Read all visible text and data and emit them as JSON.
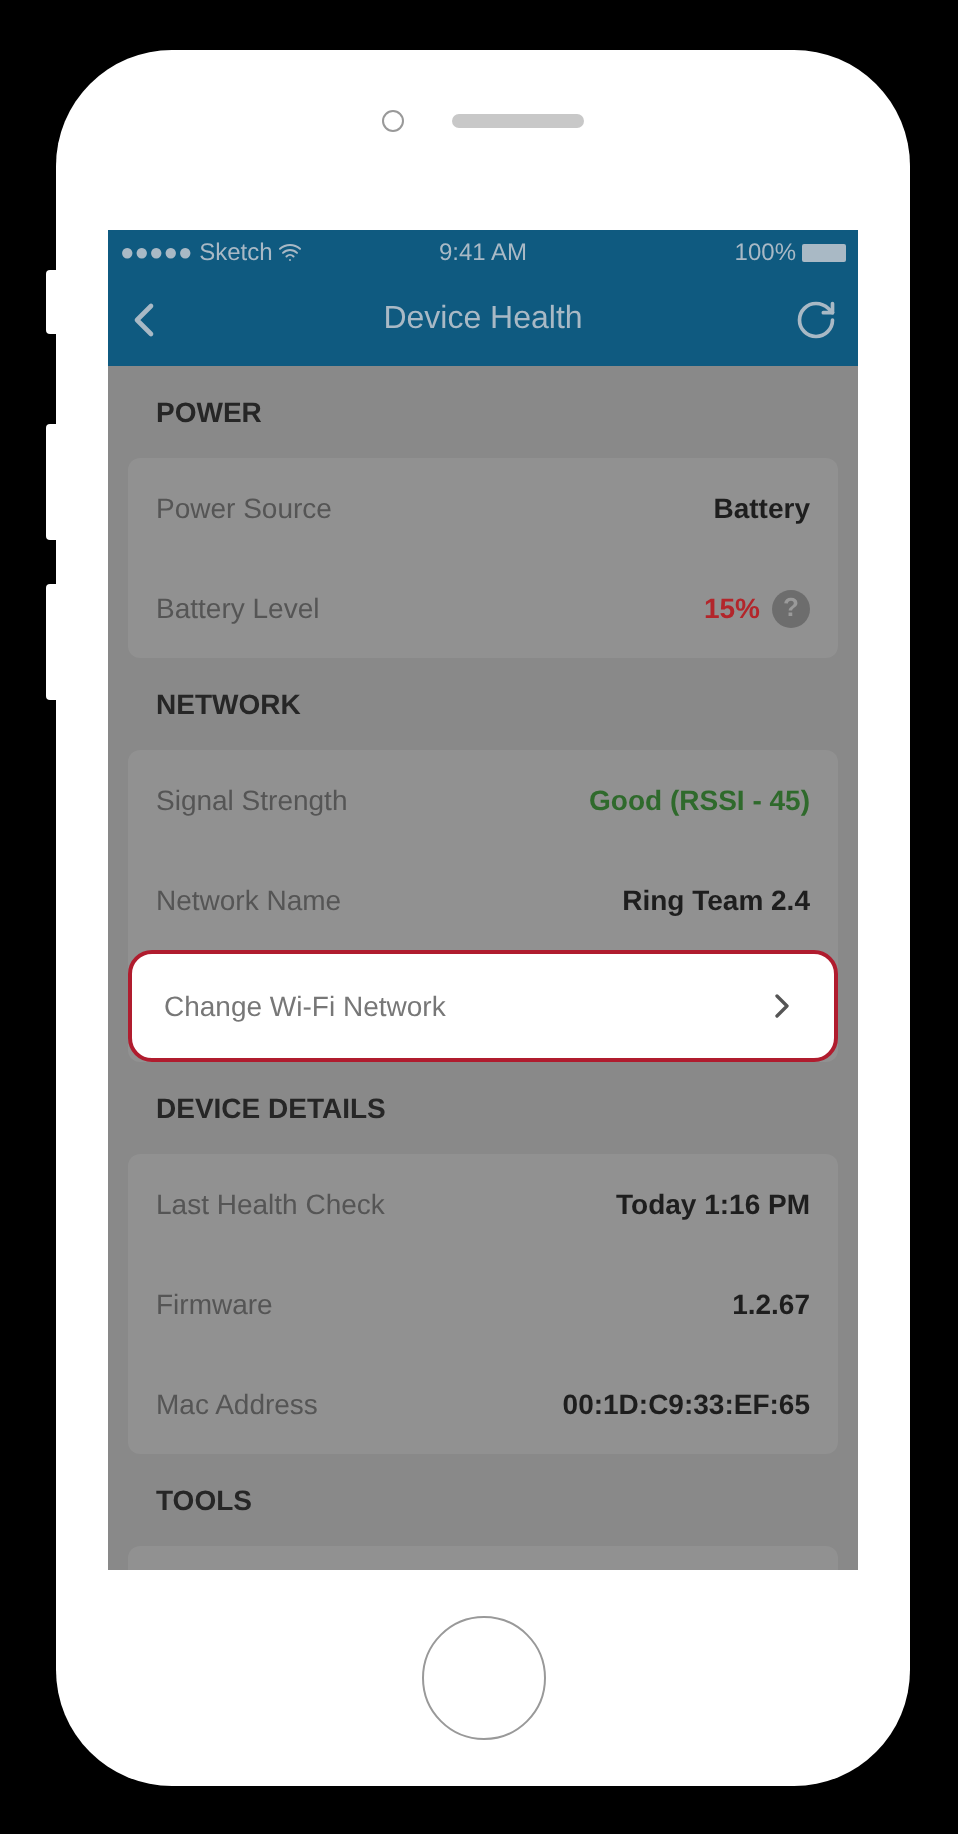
{
  "status_bar": {
    "carrier": "●●●●● Sketch",
    "time": "9:41 AM",
    "battery": "100%"
  },
  "nav_bar": {
    "title": "Device Health"
  },
  "sections": [
    {
      "title": "POWER",
      "rows": [
        {
          "kind": "value",
          "label": "Power Source",
          "value": "Battery"
        },
        {
          "kind": "value",
          "label": "Battery Level",
          "value": "15%",
          "color": "#b3262b",
          "help": "?"
        }
      ]
    },
    {
      "title": "NETWORK",
      "rows": [
        {
          "kind": "value",
          "label": "Signal Strength",
          "value": "Good (RSSI - 45)",
          "color": "#2f6a2c"
        },
        {
          "kind": "value",
          "label": "Network Name",
          "value": "Ring Team 2.4"
        },
        {
          "kind": "link",
          "label": "Change Wi-Fi Network"
        }
      ]
    },
    {
      "title": "DEVICE DETAILS",
      "rows": [
        {
          "kind": "value",
          "label": "Last Health Check",
          "value": "Today 1:16 PM"
        },
        {
          "kind": "value",
          "label": "Firmware",
          "value": "1.2.67"
        },
        {
          "kind": "value",
          "label": "Mac Address",
          "value": "00:1D:C9:33:EF:65"
        }
      ]
    },
    {
      "title": "TOOLS"
    }
  ]
}
